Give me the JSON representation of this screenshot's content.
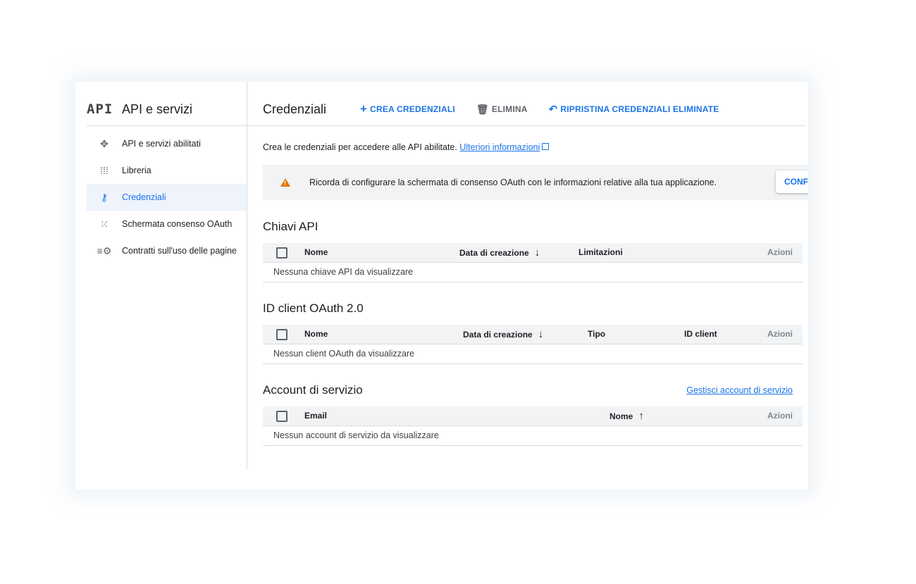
{
  "sidebar": {
    "logo": "API",
    "title": "API e servizi",
    "items": [
      {
        "label": "API e servizi abilitati",
        "icon": "api-icon"
      },
      {
        "label": "Libreria",
        "icon": "library-icon"
      },
      {
        "label": "Credenziali",
        "icon": "key-icon",
        "active": true
      },
      {
        "label": "Schermata consenso OAuth",
        "icon": "consent-icon"
      },
      {
        "label": "Contratti sull'uso delle pagine",
        "icon": "settings-list-icon"
      }
    ]
  },
  "toolbar": {
    "title": "Credenziali",
    "create_label": "CREA CREDENZIALI",
    "delete_label": "ELIMINA",
    "restore_label": "RIPRISTINA CREDENZIALI ELIMINATE"
  },
  "info": {
    "text": "Crea le credenziali per accedere alle API abilitate.",
    "link": "Ulteriori informazioni"
  },
  "banner": {
    "text": "Ricorda di configurare la schermata di consenso OAuth con le informazioni relative alla tua applicazione.",
    "button": "CONFIGURA"
  },
  "api_keys": {
    "title": "Chiavi API",
    "columns": [
      "Nome",
      "Data di creazione",
      "Limitazioni",
      "Azioni"
    ],
    "empty": "Nessuna chiave API da visualizzare"
  },
  "oauth": {
    "title": "ID client OAuth 2.0",
    "columns": [
      "Nome",
      "Data di creazione",
      "Tipo",
      "ID client",
      "Azioni"
    ],
    "empty": "Nessun client OAuth da visualizzare"
  },
  "service_accounts": {
    "title": "Account di servizio",
    "manage_link": "Gestisci account di servizio",
    "columns": [
      "Email",
      "Nome",
      "Azioni"
    ],
    "empty": "Nessun account di servizio da visualizzare"
  },
  "colors": {
    "accent": "#1a73e8",
    "warning": "#e37400",
    "active_bg": "#eef3fc"
  }
}
